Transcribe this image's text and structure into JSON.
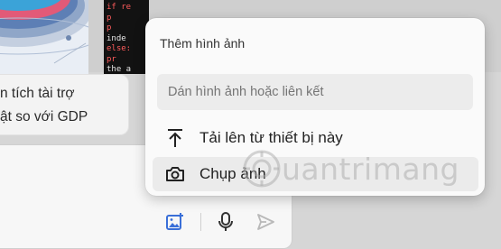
{
  "background": {
    "code_lines": [
      {
        "text": "if re",
        "color": "red"
      },
      {
        "text": "  p",
        "color": "red"
      },
      {
        "text": "  p",
        "color": "red"
      },
      {
        "text": "inde",
        "color": "white"
      },
      {
        "text": "else:",
        "color": "red"
      },
      {
        "text": "  pr",
        "color": "red"
      },
      {
        "text": "the a",
        "color": "white"
      }
    ],
    "text_card": {
      "line1": "n tích tài trợ",
      "line2": "ật so với GDP"
    }
  },
  "image_menu": {
    "title": "Thêm hình ảnh",
    "link_input_placeholder": "Dán hình ảnh hoặc liên kết",
    "items": [
      {
        "label": "Tải lên từ thiết bị này",
        "icon": "upload-icon"
      },
      {
        "label": "Chụp ảnh",
        "icon": "camera-icon"
      }
    ]
  },
  "composer": {
    "icons": [
      "image-add-icon",
      "microphone-icon",
      "send-icon"
    ]
  },
  "watermark": {
    "text": "uantrimang"
  },
  "colors": {
    "accent": "#3a6fd8",
    "menu_bg": "#fafafa",
    "input_bg": "#ececec",
    "hover_bg": "#ebebeb"
  }
}
